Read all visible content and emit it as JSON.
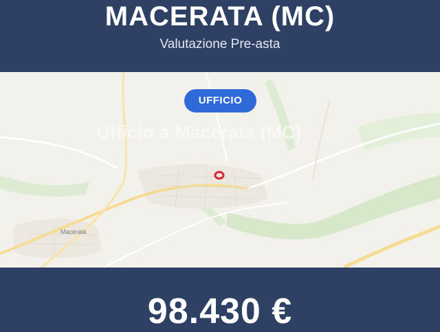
{
  "header": {
    "title": "MACERATA (MC)",
    "subtitle": "Valutazione Pre-asta"
  },
  "map": {
    "category_badge": "UFFICIO",
    "overlay_title": "Ufficio a Macerata (MC)",
    "place_label": "Macerata",
    "marker_icon": "location-marker-icon",
    "colors": {
      "background": "#f3f1ec",
      "green": "#cfe3c2",
      "road": "#f4d98a",
      "marker": "#d6243a"
    }
  },
  "footer": {
    "price": "98.430 €"
  },
  "colors": {
    "header_bg": "#2e4063",
    "badge_bg": "#2f6ad9"
  }
}
